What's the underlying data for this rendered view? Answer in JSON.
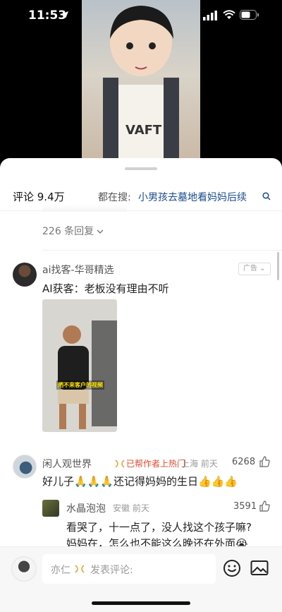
{
  "status_bar": {
    "time": "11:53"
  },
  "header": {
    "comment_count": "评论 9.4万",
    "search_hint": "都在搜:",
    "search_term": "小男孩去墓地看妈妈后续"
  },
  "replies_toggle": "226 条回复",
  "ad": {
    "name": "ai找客-华哥精选",
    "badge": "广告",
    "text": "AI获客：老板没有理由不听",
    "media_caption": "晒不来客户的视频"
  },
  "comments": [
    {
      "name": "闲人观世界",
      "hot": "已帮作者上热门",
      "meta": "上海 前天",
      "likes": "6268",
      "text": "好儿子🙏🙏🙏还记得妈妈的生日👍👍👍"
    }
  ],
  "reply": {
    "name": "水晶泡泡",
    "meta": "安徽 前天",
    "likes": "3591",
    "line1": "看哭了，十一点了，没人找这个孩子嘛?",
    "line2": "妈妈在，怎么也不能这么晚还在外面😭"
  },
  "input_bar": {
    "user": "亦仁",
    "placeholder": "发表评论:"
  }
}
